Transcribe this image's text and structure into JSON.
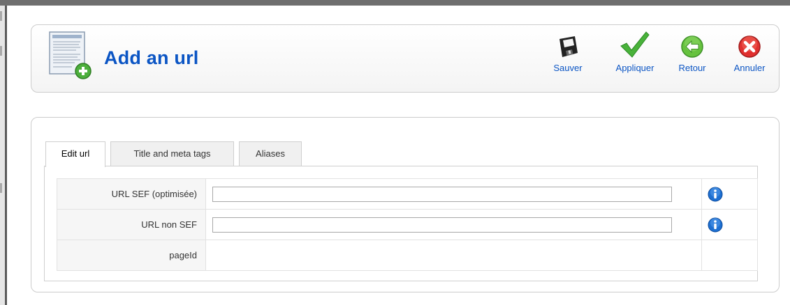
{
  "page": {
    "title": "Add an url"
  },
  "toolbar": {
    "buttons": [
      {
        "label": "Sauver",
        "icon": "floppy-disk-icon"
      },
      {
        "label": "Appliquer",
        "icon": "checkmark-icon"
      },
      {
        "label": "Retour",
        "icon": "back-arrow-icon"
      },
      {
        "label": "Annuler",
        "icon": "cancel-x-icon"
      }
    ]
  },
  "tabs": [
    {
      "label": "Edit url",
      "active": true
    },
    {
      "label": "Title and meta tags",
      "active": false
    },
    {
      "label": "Aliases",
      "active": false
    }
  ],
  "form": {
    "rows": [
      {
        "label": "URL SEF (optimisée)",
        "value": "",
        "has_help": true
      },
      {
        "label": "URL non SEF",
        "value": "",
        "has_help": true
      },
      {
        "label": "pageId",
        "value": "",
        "has_help": false
      }
    ]
  },
  "colors": {
    "title": "#0b55c4",
    "link": "#0b55c4",
    "check": "#3aa33a",
    "back": "#5bbf3a",
    "cancel": "#d8252a",
    "info": "#1d6fd1"
  }
}
